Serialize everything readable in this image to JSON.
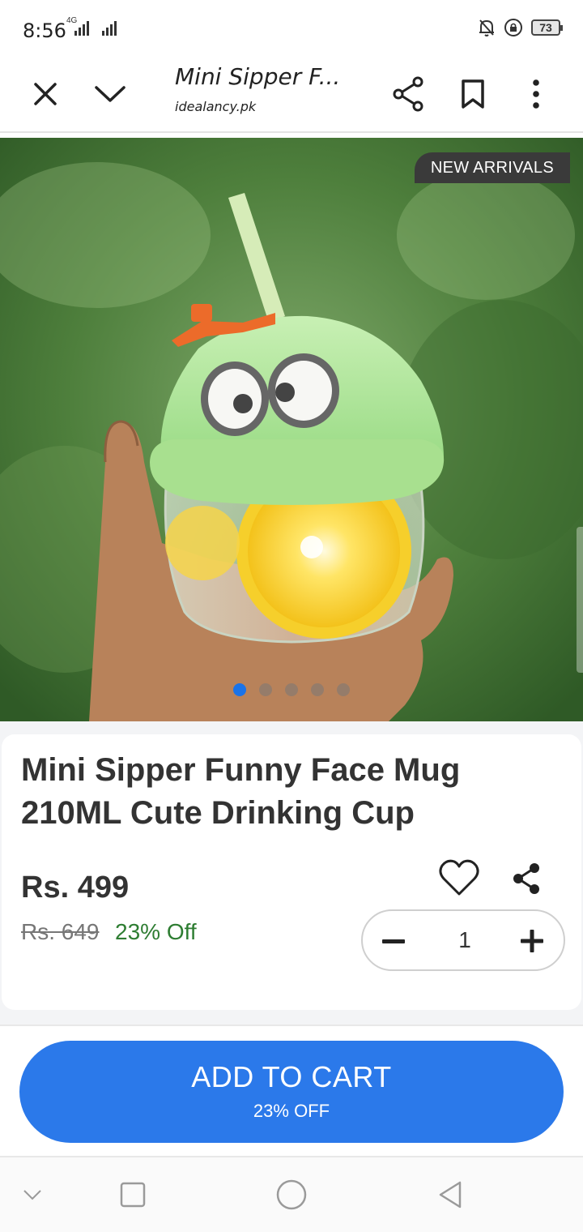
{
  "status_bar": {
    "time": "8:56",
    "network": "4G",
    "battery": "73"
  },
  "toolbar": {
    "title": "Mini Sipper F...",
    "site": "idealancy.pk"
  },
  "hero": {
    "badge": "NEW ARRIVALS",
    "carousel": {
      "current": 1,
      "total": 5
    }
  },
  "product": {
    "title": "Mini Sipper Funny Face Mug 210ML Cute Drinking Cup",
    "price": "Rs. 499",
    "old_price": "Rs. 649",
    "discount": "23% Off",
    "quantity": "1"
  },
  "cart": {
    "label": "ADD TO CART",
    "sub": "23% OFF"
  },
  "colors": {
    "accent": "#2b79ea",
    "discount": "#2e7d32",
    "active_dot": "#1a73e8"
  },
  "icons": [
    "close-icon",
    "chevron-down-icon",
    "share-icon",
    "bookmark-icon",
    "more-vertical-icon",
    "heart-icon",
    "minus-icon",
    "plus-icon"
  ]
}
